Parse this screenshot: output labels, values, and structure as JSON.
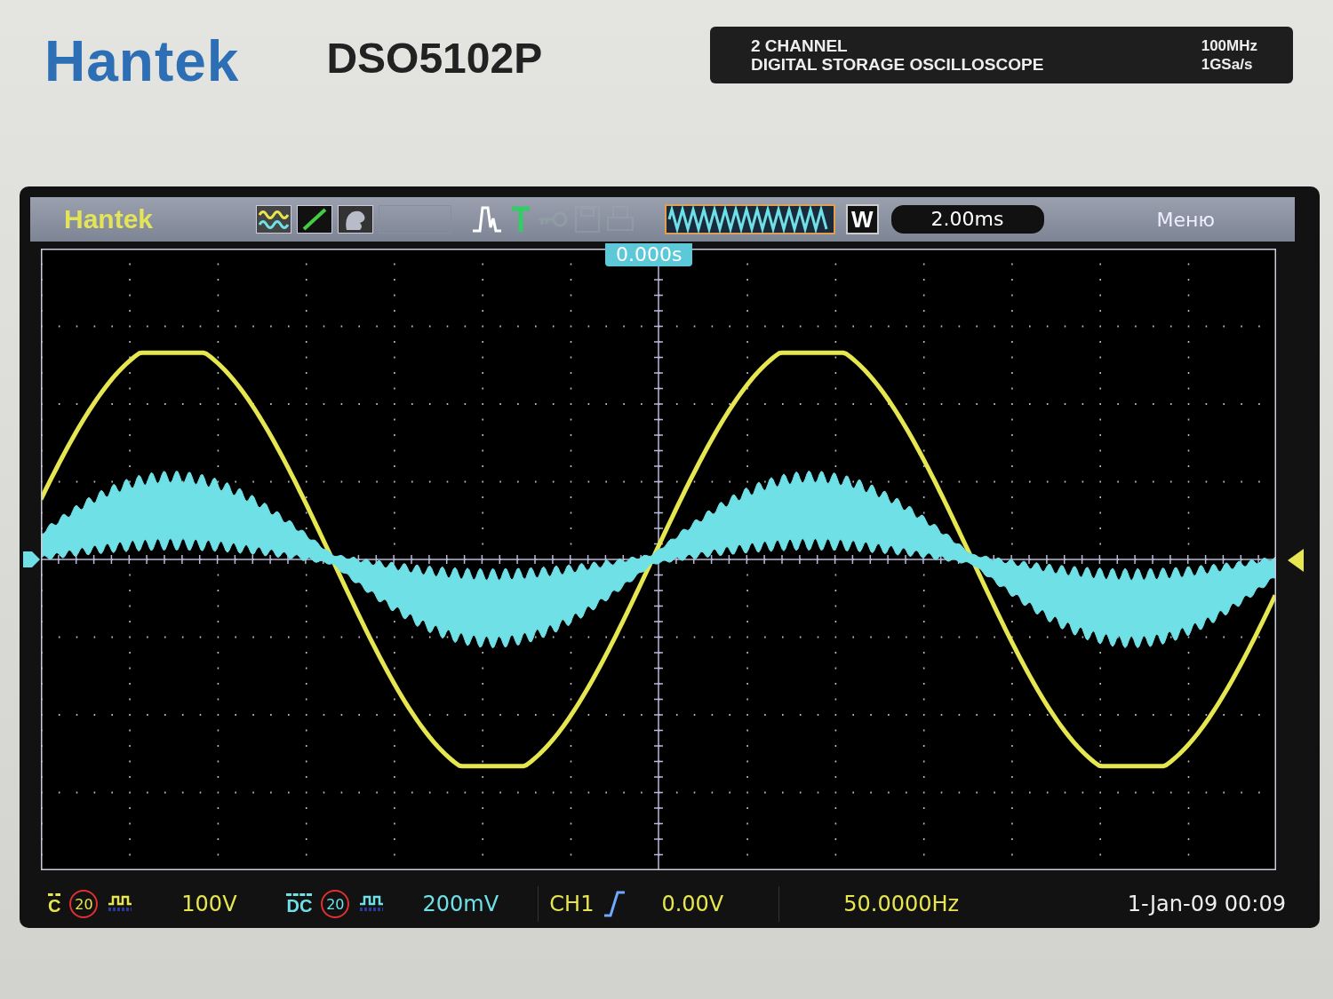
{
  "bezel": {
    "brand": "Hantek",
    "model": "DSO5102P",
    "badge_lines": [
      "2 CHANNEL",
      "DIGITAL STORAGE OSCILLOSCOPE"
    ],
    "specs": [
      "100MHz",
      "1GSa/s"
    ]
  },
  "top_bar": {
    "logo": "Hantek",
    "timebase_mode": "W",
    "timebase": "2.00ms",
    "menu": "Меню"
  },
  "trigger_position": "0.000s",
  "channels": [
    {
      "coupling": "C",
      "bw_limit": "20",
      "scale": "100V",
      "color": "#e6e650",
      "kind": "sine"
    },
    {
      "coupling": "DC",
      "bw_limit": "20",
      "scale": "200mV",
      "color": "#6fe0e6",
      "kind": "modulated"
    }
  ],
  "trigger": {
    "source": "CH1",
    "level": "0.00V"
  },
  "frequency": "50.0000Hz",
  "datetime": "1-Jan-09 00:09"
}
